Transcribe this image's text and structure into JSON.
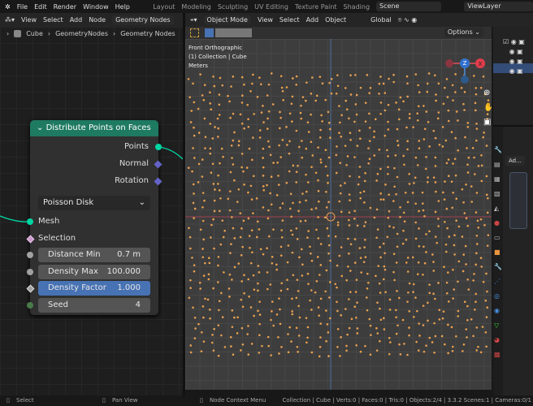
{
  "topbar": {
    "menus": [
      "File",
      "Edit",
      "Render",
      "Window",
      "Help"
    ],
    "workspaces": [
      "Layout",
      "Modeling",
      "Sculpting",
      "UV Editing",
      "Texture Paint",
      "Shading"
    ],
    "scene": "Scene",
    "view_layer": "ViewLayer"
  },
  "node_editor": {
    "menus": [
      "View",
      "Select",
      "Add",
      "Node"
    ],
    "tree_name": "Geometry Nodes",
    "breadcrumb": [
      "Cube",
      "GeometryNodes",
      "Geometry Nodes"
    ]
  },
  "node": {
    "title": "Distribute Points on Faces",
    "outputs": [
      "Points",
      "Normal",
      "Rotation"
    ],
    "mode": "Poisson Disk",
    "inputs": {
      "mesh": "Mesh",
      "selection": "Selection"
    },
    "props": [
      {
        "label": "Distance Min",
        "value": "0.7 m"
      },
      {
        "label": "Density Max",
        "value": "100.000"
      },
      {
        "label": "Density Factor",
        "value": "1.000"
      },
      {
        "label": "Seed",
        "value": "4"
      }
    ],
    "colors": {
      "header": "#1f7a62",
      "geometry_socket": "#00d6a3",
      "vector_socket": "#6363c7",
      "active_field": "#4772b3"
    }
  },
  "viewport": {
    "mode": "Object Mode",
    "menus": [
      "View",
      "Select",
      "Add",
      "Object"
    ],
    "orientation": "Global",
    "options": "Options",
    "overlay": [
      "Front Orthographic",
      "(1) Collection | Cube",
      "Meters"
    ],
    "gizmo": {
      "z": "Z",
      "y": "Y",
      "x": "X"
    },
    "point_color": "#e8a050"
  },
  "properties": {
    "dropdown": "Ad..."
  },
  "status": {
    "select": "Select",
    "pan": "Pan View",
    "context": "Node Context Menu",
    "info": "Collection | Cube | Verts:0 | Faces:0 | Tris:0 | Objects:2/4 | 3.3.2  Scenes:1 | Cameras:0/1"
  }
}
